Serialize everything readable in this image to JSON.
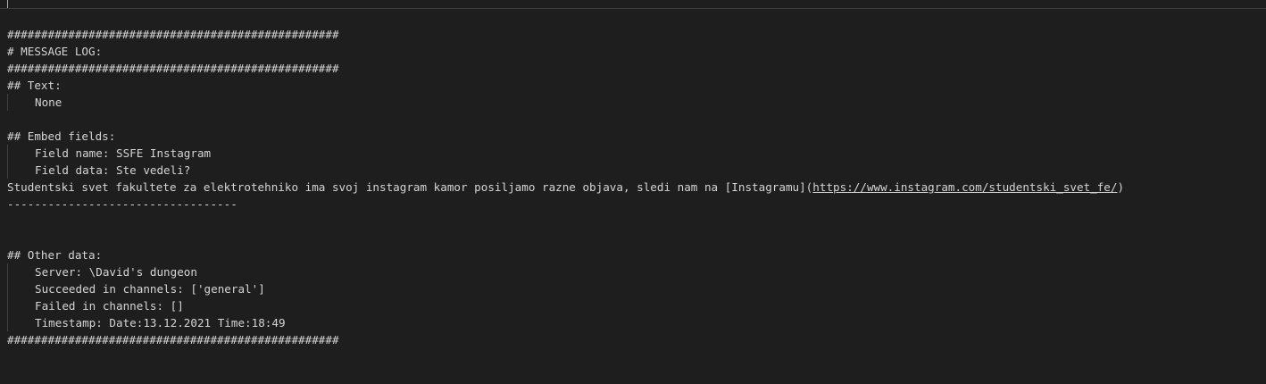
{
  "output": {
    "border_top": "#################################################",
    "header_title": "# MESSAGE LOG:",
    "border_mid": "#################################################",
    "text_heading": "## Text:",
    "text_value": "None",
    "blank1": "",
    "embed_heading": "## Embed fields:",
    "field_name": "Field name: SSFE Instagram",
    "field_data": "Field data: Ste vedeli?",
    "message_prefix": "Studentski svet fakultete za elektrotehniko ima svoj instagram kamor posiljamo razne objava, sledi nam na [Instagramu](",
    "message_link": "https://www.instagram.com/studentski_svet_fe/",
    "message_suffix": ")",
    "separator": "----------------------------------",
    "other_heading": "## Other data:",
    "server": "Server: \\David's dungeon",
    "succeeded": "Succeeded in channels: ['general']",
    "failed": "Failed in channels: []",
    "timestamp": "Timestamp: Date:13.12.2021 Time:18:49",
    "border_bottom": "#################################################"
  },
  "colors": {
    "background": "#1e1e1e",
    "text": "#d4d4d4",
    "indent_guide": "#404040",
    "input_border": "#3c3c3c"
  }
}
